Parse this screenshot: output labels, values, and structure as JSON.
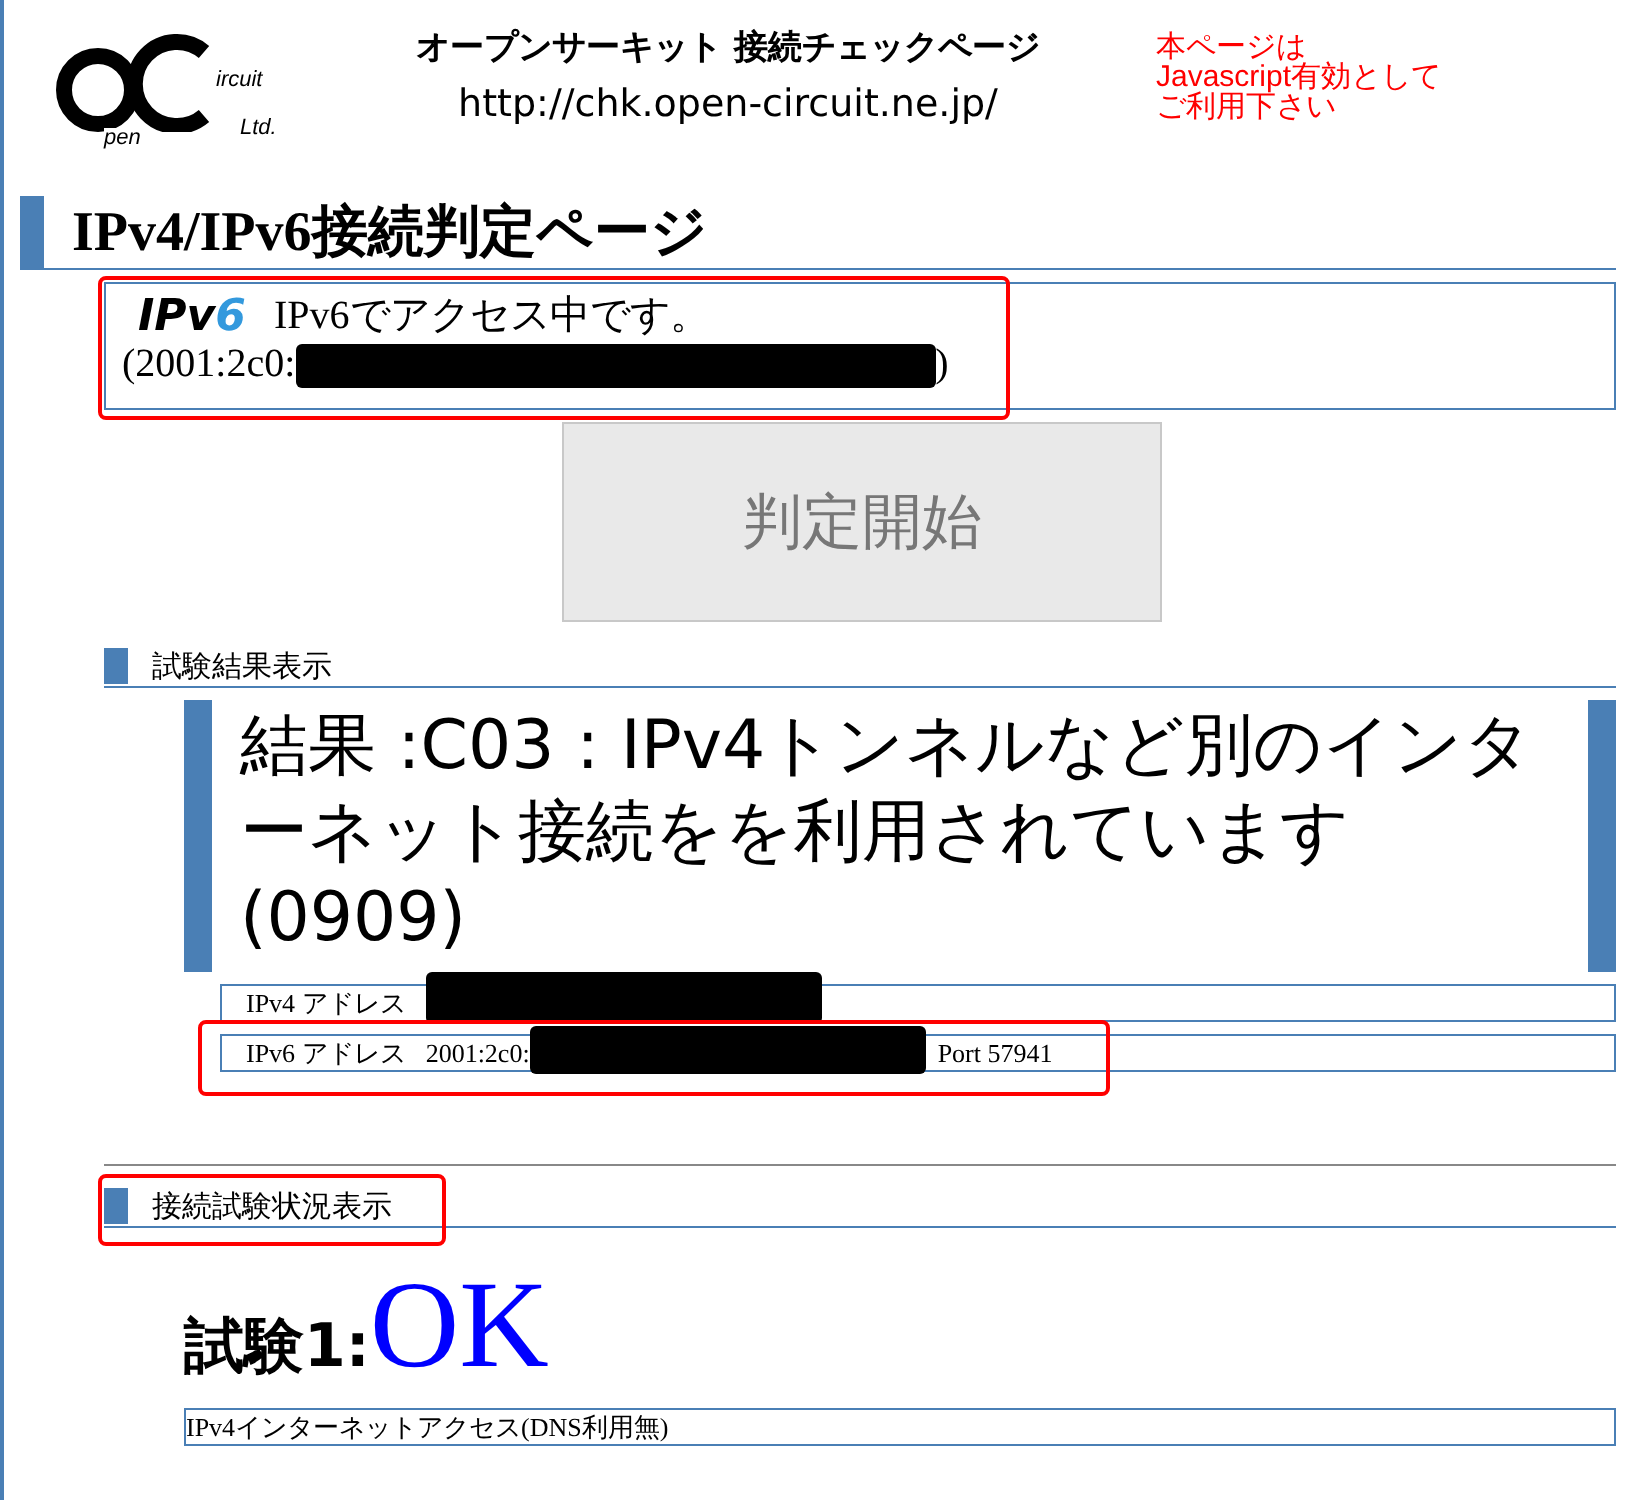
{
  "header": {
    "logo_words": [
      "ircuit",
      "pen",
      "Ltd."
    ],
    "title": "オープンサーキット 接続チェックページ",
    "url": "http://chk.open-circuit.ne.jp/",
    "note_lines": [
      "本ページは",
      "Javascript有効として",
      "ご利用下さい"
    ]
  },
  "page_title": "IPv4/IPv6接続判定ページ",
  "access": {
    "badge_text": "IPv",
    "badge_digit": "6",
    "message": "IPv6でアクセス中です。",
    "address_prefix": "(2001:2c0:",
    "address_suffix": ")"
  },
  "start_button": {
    "label": "判定開始",
    "disabled": true
  },
  "result_section": {
    "heading": "試験結果表示",
    "result": "結果 :C03 : IPv4トンネルなど別のインターネット接続をを利用されています(0909)",
    "addresses": [
      {
        "label": "IPv4 アドレス"
      },
      {
        "label": "IPv6 アドレス",
        "value_prefix": "2001:2c0:",
        "port": "Port 57941"
      }
    ]
  },
  "status_section": {
    "heading": "接続試験状況表示",
    "tests": [
      {
        "label": "試験1:",
        "result": "OK",
        "detail": "IPv4インターネットアクセス(DNS利用無)"
      }
    ]
  }
}
